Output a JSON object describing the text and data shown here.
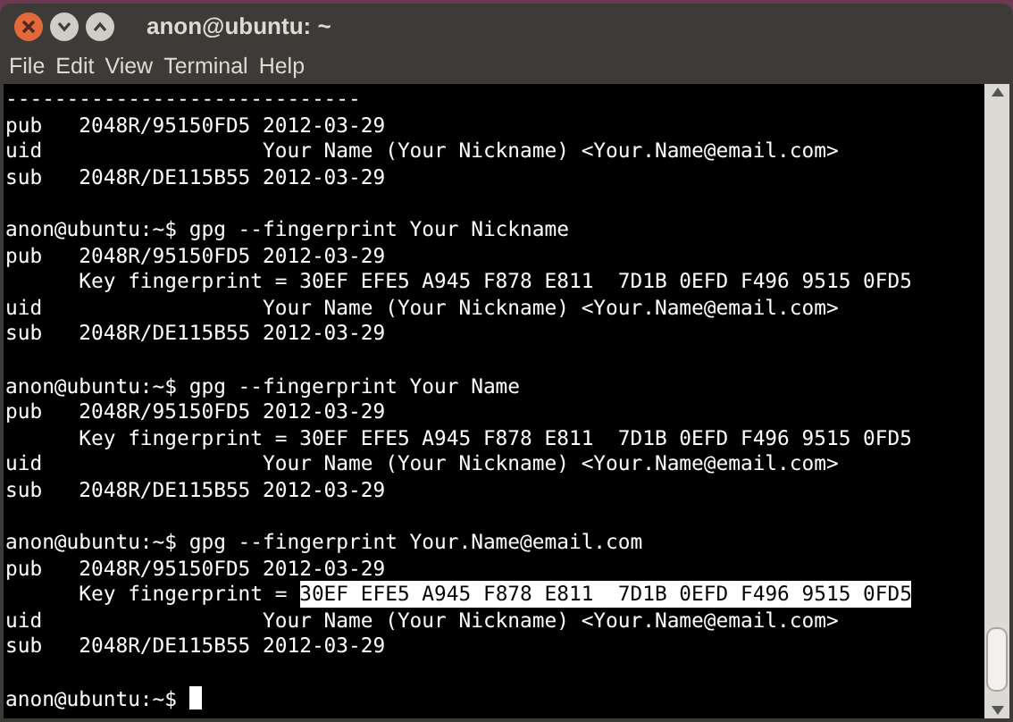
{
  "window": {
    "title": "anon@ubuntu: ~"
  },
  "menu": [
    "File",
    "Edit",
    "View",
    "Terminal",
    "Help"
  ],
  "lines": [
    {
      "kind": "output",
      "text": "-----------------------------"
    },
    {
      "kind": "output",
      "text": "pub   2048R/95150FD5 2012-03-29"
    },
    {
      "kind": "output",
      "text": "uid                  Your Name (Your Nickname) <Your.Name@email.com>"
    },
    {
      "kind": "output",
      "text": "sub   2048R/DE115B55 2012-03-29"
    },
    {
      "kind": "blank"
    },
    {
      "kind": "output",
      "text": "anon@ubuntu:~$ gpg --fingerprint Your Nickname"
    },
    {
      "kind": "output",
      "text": "pub   2048R/95150FD5 2012-03-29"
    },
    {
      "kind": "output",
      "text": "      Key fingerprint = 30EF EFE5 A945 F878 E811  7D1B 0EFD F496 9515 0FD5"
    },
    {
      "kind": "output",
      "text": "uid                  Your Name (Your Nickname) <Your.Name@email.com>"
    },
    {
      "kind": "output",
      "text": "sub   2048R/DE115B55 2012-03-29"
    },
    {
      "kind": "blank"
    },
    {
      "kind": "output",
      "text": "anon@ubuntu:~$ gpg --fingerprint Your Name"
    },
    {
      "kind": "output",
      "text": "pub   2048R/95150FD5 2012-03-29"
    },
    {
      "kind": "output",
      "text": "      Key fingerprint = 30EF EFE5 A945 F878 E811  7D1B 0EFD F496 9515 0FD5"
    },
    {
      "kind": "output",
      "text": "uid                  Your Name (Your Nickname) <Your.Name@email.com>"
    },
    {
      "kind": "output",
      "text": "sub   2048R/DE115B55 2012-03-29"
    },
    {
      "kind": "blank"
    },
    {
      "kind": "output",
      "text": "anon@ubuntu:~$ gpg --fingerprint Your.Name@email.com"
    },
    {
      "kind": "output",
      "text": "pub   2048R/95150FD5 2012-03-29"
    },
    {
      "kind": "selection",
      "text": "      Key fingerprint = ",
      "selection": "30EF EFE5 A945 F878 E811  7D1B 0EFD F496 9515 0FD5"
    },
    {
      "kind": "output",
      "text": "uid                  Your Name (Your Nickname) <Your.Name@email.com>"
    },
    {
      "kind": "output",
      "text": "sub   2048R/DE115B55 2012-03-29"
    },
    {
      "kind": "blank"
    },
    {
      "kind": "prompt",
      "text": "anon@ubuntu:~$ ",
      "cursor": true
    }
  ]
}
